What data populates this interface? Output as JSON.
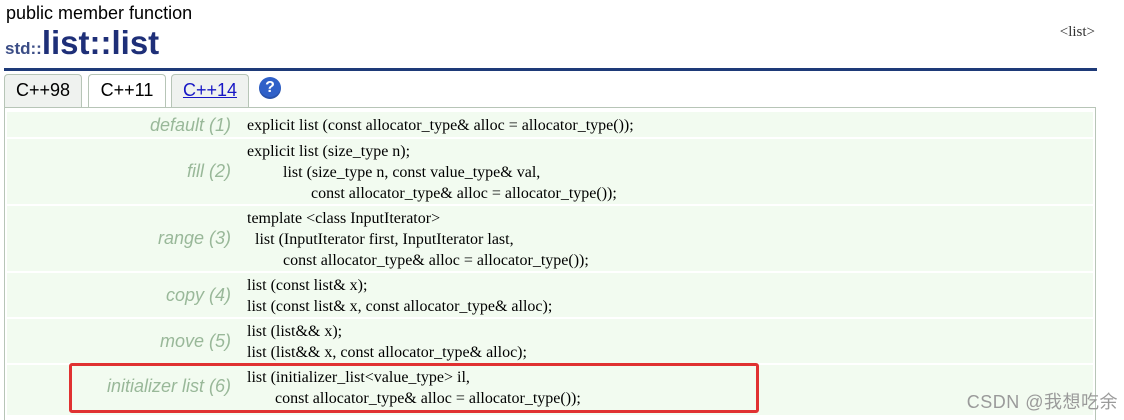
{
  "header": {
    "kind": "public member function",
    "namespace": "std::",
    "name": "list::list",
    "header_ref": "<list>"
  },
  "tabs": [
    {
      "label": "C++98",
      "state": "inactive"
    },
    {
      "label": "C++11",
      "state": "active"
    },
    {
      "label": "C++14",
      "state": "link"
    }
  ],
  "help_icon": "?",
  "signatures": [
    {
      "label": "default (1)",
      "code": "explicit list (const allocator_type& alloc = allocator_type());"
    },
    {
      "label": "fill (2)",
      "code": "explicit list (size_type n);\n         list (size_type n, const value_type& val,\n                const allocator_type& alloc = allocator_type());"
    },
    {
      "label": "range (3)",
      "code": "template <class InputIterator>\n  list (InputIterator first, InputIterator last,\n         const allocator_type& alloc = allocator_type());"
    },
    {
      "label": "copy (4)",
      "code": "list (const list& x);\nlist (const list& x, const allocator_type& alloc);"
    },
    {
      "label": "move (5)",
      "code": "list (list&& x);\nlist (list&& x, const allocator_type& alloc);"
    },
    {
      "label": "initializer list (6)",
      "code": "list (initializer_list<value_type> il,\n       const allocator_type& alloc = allocator_type());"
    }
  ],
  "watermark": "CSDN @我想吃余",
  "colors": {
    "title": "#1e2f78",
    "rule": "#1e3a78",
    "row_bg": "#f2fbf0",
    "label": "#99b899",
    "highlight": "#e03131",
    "tab_link": "#1717c5"
  }
}
